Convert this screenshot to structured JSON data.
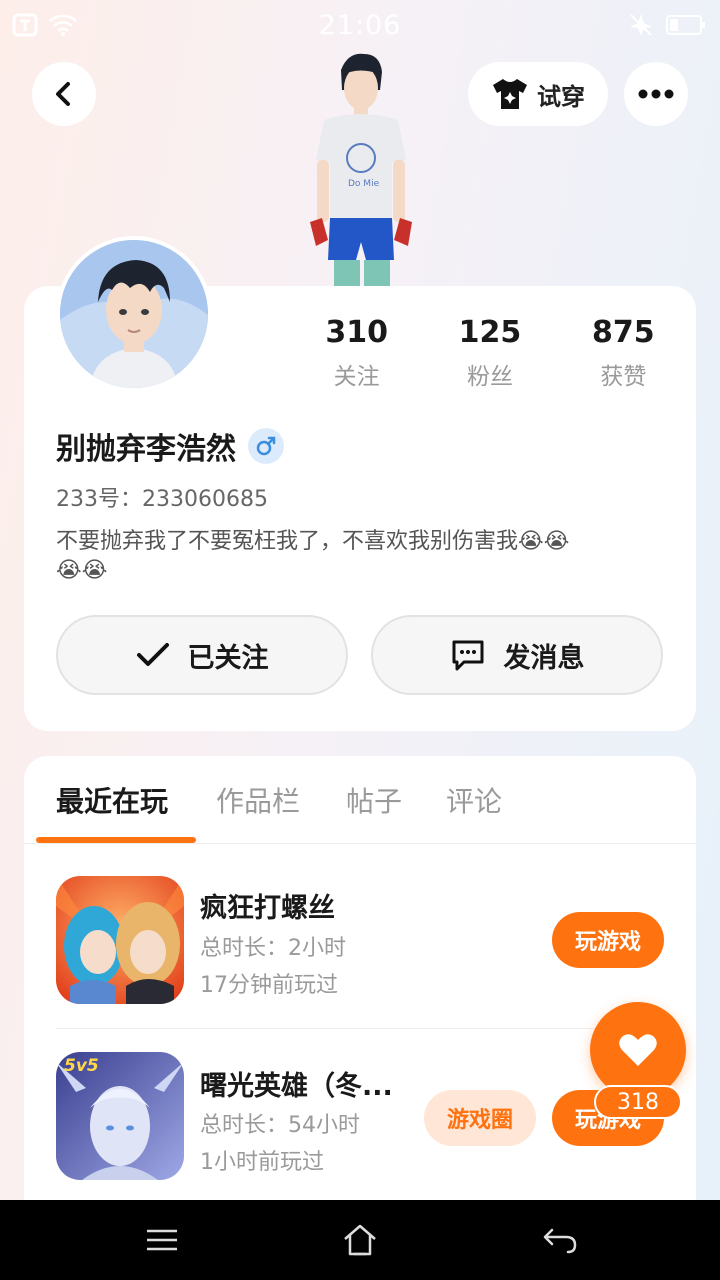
{
  "status_bar": {
    "time": "21:06"
  },
  "header": {
    "try_on_label": "试穿"
  },
  "profile": {
    "username": "别抛弃李浩然",
    "user_id": "233号：233060685",
    "bio": "不要抛弃我了不要冤枉我了，不喜欢我别伤害我😭😭😭😭",
    "stats": [
      {
        "value": "310",
        "label": "关注"
      },
      {
        "value": "125",
        "label": "粉丝"
      },
      {
        "value": "875",
        "label": "获赞"
      }
    ],
    "follow_label": "已关注",
    "message_label": "发消息"
  },
  "tabs": [
    {
      "label": "最近在玩"
    },
    {
      "label": "作品栏"
    },
    {
      "label": "帖子"
    },
    {
      "label": "评论"
    }
  ],
  "games": [
    {
      "title": "疯狂打螺丝",
      "duration": "总时长：2小时",
      "last_played": "17分钟前玩过",
      "play_label": "玩游戏"
    },
    {
      "title": "曙光英雄（冬...",
      "duration": "总时长：54小时",
      "last_played": "1小时前玩过",
      "play_label": "玩游戏",
      "circle_label": "游戏圈",
      "badge": "5v5"
    }
  ],
  "like": {
    "count": "318"
  },
  "colors": {
    "accent": "#ff7210",
    "gender": "#3b8ddd"
  }
}
